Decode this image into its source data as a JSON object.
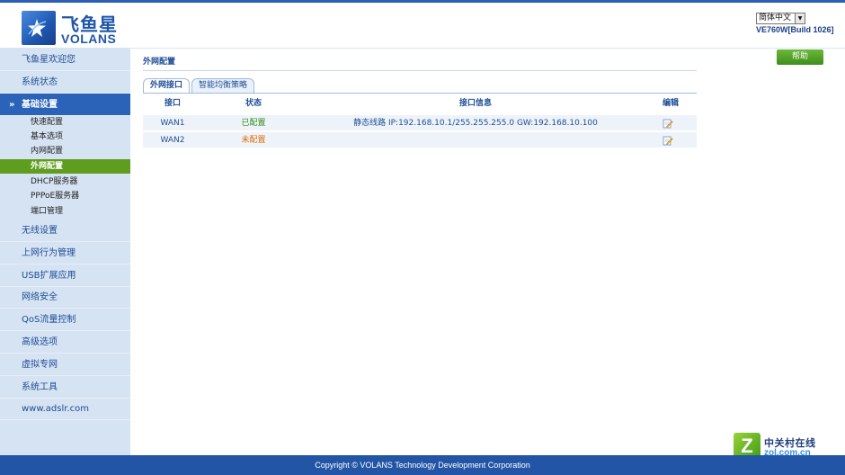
{
  "brand": {
    "name_cn": "飞鱼星",
    "name_en": "VOLANS",
    "logo_icon": "star-swoosh-icon",
    "accent": "#2a63b8"
  },
  "header": {
    "language": "简体中文",
    "firmware": "VE760W[Build 1026]"
  },
  "sidebar": {
    "items": [
      {
        "label": "飞鱼星欢迎您"
      },
      {
        "label": "系统状态"
      },
      {
        "label": "基础设置",
        "active": true
      },
      {
        "label": "无线设置"
      },
      {
        "label": "上网行为管理"
      },
      {
        "label": "USB扩展应用"
      },
      {
        "label": "网络安全"
      },
      {
        "label": "QoS流量控制"
      },
      {
        "label": "高级选项"
      },
      {
        "label": "虚拟专网"
      },
      {
        "label": "系统工具"
      },
      {
        "label": "www.adslr.com"
      }
    ],
    "sub_items": [
      {
        "label": "快速配置"
      },
      {
        "label": "基本选项"
      },
      {
        "label": "内网配置"
      },
      {
        "label": "外网配置",
        "selected": true
      },
      {
        "label": "DHCP服务器"
      },
      {
        "label": "PPPoE服务器"
      },
      {
        "label": "端口管理"
      }
    ]
  },
  "main": {
    "title": "外网配置",
    "help_label": "帮助",
    "tabs": [
      {
        "label": "外网接口",
        "active": true
      },
      {
        "label": "智能均衡策略"
      }
    ],
    "table": {
      "headers": [
        "接口",
        "状态",
        "接口信息",
        "编辑"
      ],
      "rows": [
        {
          "port": "WAN1",
          "status": "已配置",
          "info": "静态线路 IP:192.168.10.1/255.255.255.0   GW:192.168.10.100"
        },
        {
          "port": "WAN2",
          "status": "未配置",
          "info": ""
        }
      ]
    }
  },
  "footer": {
    "copyright": "Copyright © VOLANS Technology Development Corporation"
  },
  "watermark": {
    "cn": "中关村在线",
    "en": "zol.com.cn"
  },
  "colors": {
    "header_bar": "#2b5fb3",
    "sidebar_bg": "#d6e3f3",
    "selected_sub": "#5e9d1e",
    "configured": "#2e8b1c",
    "unconfigured": "#e06a00",
    "footer_bg": "#2355a6"
  }
}
